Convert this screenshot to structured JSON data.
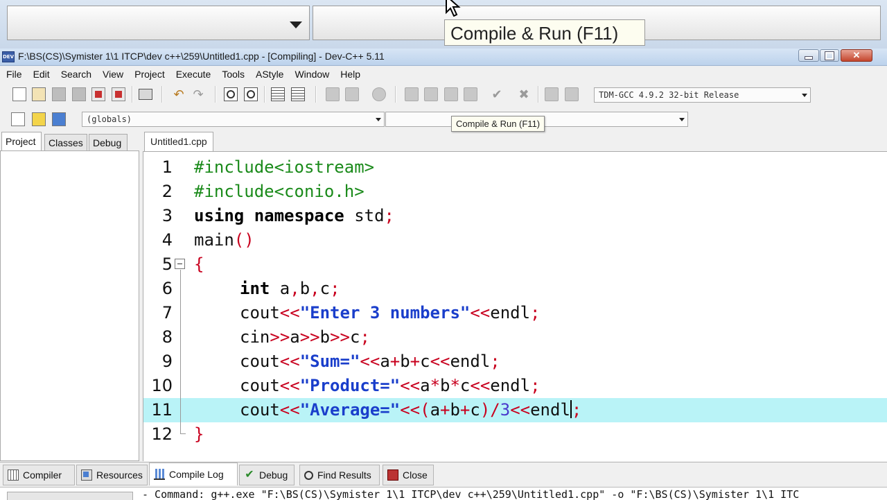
{
  "zoom": {
    "tooltip": "Compile & Run (F11)"
  },
  "window": {
    "title": "F:\\BS(CS)\\Symister 1\\1 ITCP\\dev c++\\259\\Untitled1.cpp - [Compiling] - Dev-C++ 5.11",
    "icon_text": "DEV"
  },
  "menu": [
    "File",
    "Edit",
    "Search",
    "View",
    "Project",
    "Execute",
    "Tools",
    "AStyle",
    "Window",
    "Help"
  ],
  "toolbar": {
    "compiler_select": "TDM-GCC 4.9.2 32-bit Release",
    "scope_select": "(globals)",
    "member_select": "",
    "tooltip": "Compile & Run (F11)"
  },
  "left_panel": {
    "tabs": [
      "Project",
      "Classes",
      "Debug"
    ],
    "active_tab": "Project"
  },
  "editor": {
    "tab": "Untitled1.cpp",
    "active_line": 11,
    "lines": [
      {
        "n": "1",
        "text": "#include<iostream>"
      },
      {
        "n": "2",
        "text": "#include<conio.h>"
      },
      {
        "n": "3",
        "text": "using namespace std;"
      },
      {
        "n": "4",
        "text": "main()"
      },
      {
        "n": "5",
        "text": "{"
      },
      {
        "n": "6",
        "text": "int a,b,c;"
      },
      {
        "n": "7",
        "text": "cout<<\"Enter 3 numbers\"<<endl;"
      },
      {
        "n": "8",
        "text": "cin>>a>>b>>c;"
      },
      {
        "n": "9",
        "text": "cout<<\"Sum=\"<<a+b+c<<endl;"
      },
      {
        "n": "10",
        "text": "cout<<\"Product=\"<<a*b*c<<endl;"
      },
      {
        "n": "11",
        "text": "cout<<\"Average=\"<<(a+b+c)/3<<endl;"
      },
      {
        "n": "12",
        "text": "}"
      }
    ]
  },
  "bottom_tabs": [
    "Compiler",
    "Resources",
    "Compile Log",
    "Debug",
    "Find Results",
    "Close"
  ],
  "bottom_active": "Compile Log",
  "log": {
    "text": "- Command: g++.exe \"F:\\BS(CS)\\Symister 1\\1 ITCP\\dev c++\\259\\Untitled1.cpp\" -o \"F:\\BS(CS)\\Symister 1\\1 ITC"
  },
  "colors": {
    "active_line": "#b9f3f7",
    "preprocessor": "#1a8a1a",
    "symbol": "#c8001e",
    "string": "#1a3ecb"
  }
}
